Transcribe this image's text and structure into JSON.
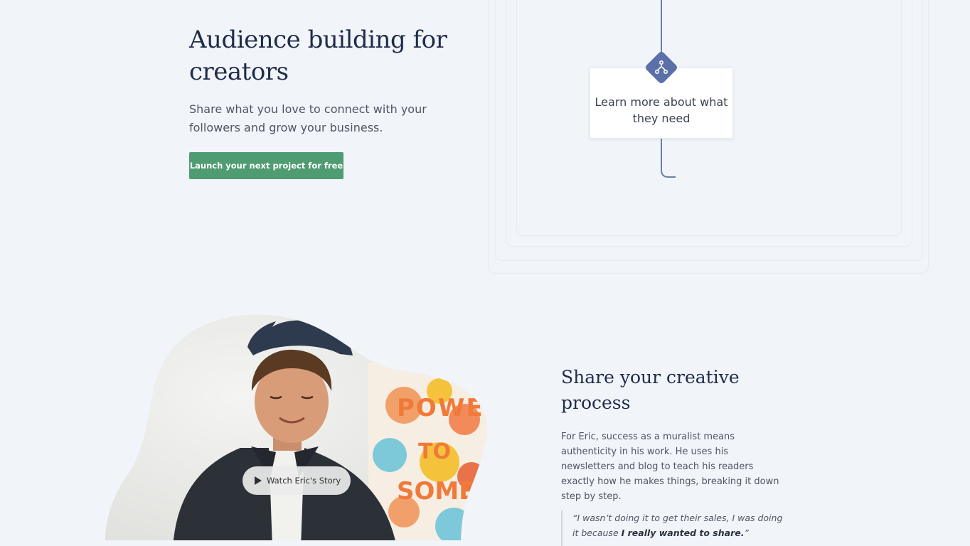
{
  "hero": {
    "title": "Audience building for creators",
    "subtitle": "Share what you love to connect with your followers and grow your business.",
    "cta_label": "Launch your next project for free"
  },
  "diagram": {
    "node_label": "Learn more about what they need",
    "node_icon": "branch-icon"
  },
  "story": {
    "watch_label": "Watch Eric's Story",
    "photo_sign_text": "POWER TO SOME"
  },
  "section": {
    "title": "Share your creative process",
    "body": "For Eric, success as a muralist means authenticity in his work. He uses his newsletters and blog to teach his readers exactly how he makes things, breaking it down step by step.",
    "quote_part1": "“I wasn’t doing it to get their sales, I was doing it because ",
    "quote_emphasis": "I really wanted to share.",
    "quote_part2": "”"
  },
  "colors": {
    "background": "#f1f4f8",
    "accent_green": "#4f9c72",
    "diagram_blue": "#5b70a8",
    "heading": "#1f2c4a"
  }
}
